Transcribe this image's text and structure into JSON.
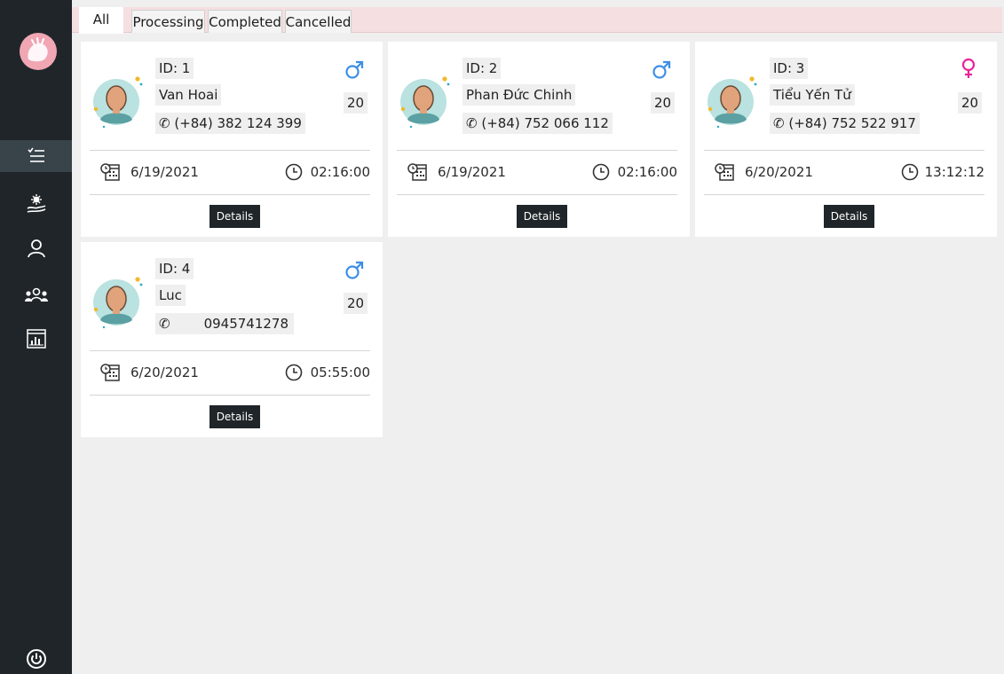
{
  "colors": {
    "sidebar": "#1f2529",
    "sidebar_active": "#39434a",
    "tab_bar": "#f6dfe1",
    "male": "#3c8ee6",
    "female": "#e8249a",
    "button": "#1f2529",
    "content_bg": "#efefef"
  },
  "sidebar": {
    "logo": "app-logo",
    "items": [
      {
        "icon": "checklist-icon",
        "active": true
      },
      {
        "icon": "hand-virus-icon",
        "active": false
      },
      {
        "icon": "user-icon",
        "active": false
      },
      {
        "icon": "users-group-icon",
        "active": false
      },
      {
        "icon": "chart-board-icon",
        "active": false
      }
    ],
    "power_icon": "power-icon"
  },
  "tabs": [
    {
      "label": "All",
      "active": true
    },
    {
      "label": "Processing",
      "active": false
    },
    {
      "label": "Completed",
      "active": false
    },
    {
      "label": "Cancelled",
      "active": false
    }
  ],
  "cards": [
    {
      "id_text": "ID: 1",
      "name": "Van Hoai",
      "phone": "(+84) 382 124 399",
      "gender": "male",
      "age": "20",
      "date": "6/19/2021",
      "time": "02:16:00",
      "button": "Details"
    },
    {
      "id_text": "ID: 2",
      "name": "Phan Đức Chinh",
      "phone": "(+84) 752 066 112",
      "gender": "male",
      "age": "20",
      "date": "6/19/2021",
      "time": "02:16:00",
      "button": "Details"
    },
    {
      "id_text": "ID: 3",
      "name": "Tiểu Yến Tử",
      "phone": "(+84) 752 522 917",
      "gender": "female",
      "age": "20",
      "date": "6/20/2021",
      "time": "13:12:12",
      "button": "Details"
    },
    {
      "id_text": "ID: 4",
      "name": "Luc",
      "phone": "0945741278",
      "gender": "male",
      "age": "20",
      "date": "6/20/2021",
      "time": "05:55:00",
      "button": "Details"
    }
  ]
}
